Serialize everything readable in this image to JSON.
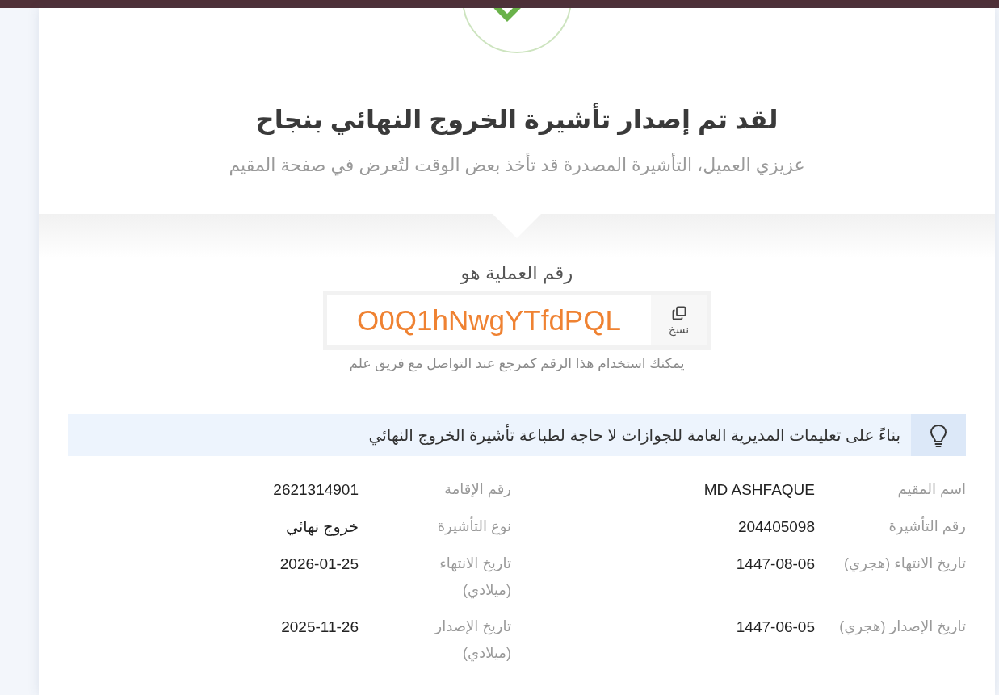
{
  "header": {
    "title": "لقد تم إصدار تأشيرة الخروج النهائي بنجاح",
    "subtitle": "عزيزي العميل، التأشيرة المصدرة قد تأخذ بعض الوقت لتُعرض في صفحة المقيم"
  },
  "reference": {
    "label": "رقم العملية هو",
    "number": "O0Q1hNwgYTfdPQL",
    "copy_button": "نسخ",
    "hint": "يمكنك استخدام هذا الرقم كمرجع عند التواصل مع فريق علم"
  },
  "notice": {
    "text": "بناءً على تعليمات المديرية العامة للجوازات لا حاجة لطباعة تأشيرة الخروج النهائي"
  },
  "details": [
    {
      "label": "اسم المقيم",
      "value": "MD ASHFAQUE"
    },
    {
      "label": "رقم الإقامة",
      "value": "2621314901"
    },
    {
      "label": "رقم التأشيرة",
      "value": "204405098"
    },
    {
      "label": "نوع التأشيرة",
      "value": "خروج نهائي"
    },
    {
      "label": "تاريخ الانتهاء (هجري)",
      "value": "1447-08-06"
    },
    {
      "label": "تاريخ الانتهاء (ميلادي)",
      "value": "2026-01-25"
    },
    {
      "label": "تاريخ الإصدار (هجري)",
      "value": "1447-06-05"
    },
    {
      "label": "تاريخ الإصدار (ميلادي)",
      "value": "2025-11-26"
    }
  ]
}
